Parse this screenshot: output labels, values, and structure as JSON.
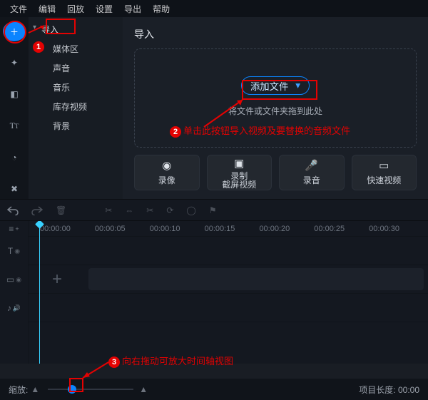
{
  "menu": [
    "文件",
    "编辑",
    "回放",
    "设置",
    "导出",
    "帮助"
  ],
  "side_tools": [
    {
      "name": "import-tool",
      "icon": "⊞",
      "active": true
    },
    {
      "name": "filters-tool",
      "icon": "✦"
    },
    {
      "name": "transitions-tool",
      "icon": "▣"
    },
    {
      "name": "titles-tool",
      "icon": "T"
    },
    {
      "name": "more-tool",
      "icon": "◔"
    },
    {
      "name": "tools-tool",
      "icon": "✕"
    }
  ],
  "import_tree": {
    "root": "导入",
    "items": [
      "媒体区",
      "声音",
      "音乐",
      "库存视频",
      "背景"
    ]
  },
  "main": {
    "title": "导入",
    "add_label": "添加文件",
    "drop_hint": "将文件或文件夹拖到此处"
  },
  "quick": [
    {
      "name": "record-camera",
      "icon": "⏺",
      "label": "录像",
      "two": null
    },
    {
      "name": "record-screen",
      "icon": "⧉",
      "line1": "录制",
      "line2": "截屏视频"
    },
    {
      "name": "record-audio",
      "icon": "🎤",
      "label": "录音",
      "two": null
    },
    {
      "name": "quick-video",
      "icon": "⧈",
      "label": "快速视频",
      "two": null
    }
  ],
  "toolbar": [
    "undo",
    "redo",
    "delete",
    "cut",
    "split",
    "crop",
    "rotate",
    "color",
    "flag"
  ],
  "ruler": [
    "00:00:00",
    "00:00:05",
    "00:00:10",
    "00:00:15",
    "00:00:20",
    "00:00:25",
    "00:00:30"
  ],
  "track_labels": [
    {
      "name": "add-track",
      "icon": "≡+"
    },
    {
      "name": "text-track",
      "icon": "T"
    },
    {
      "name": "video-track",
      "icon": "▭"
    },
    {
      "name": "audio-track",
      "icon": "♪"
    }
  ],
  "footer": {
    "zoom_label": "缩放:",
    "proj_label": "项目长度:",
    "proj_time": "00:00"
  },
  "annotations": {
    "n1": "1",
    "n2": "2",
    "n3": "3",
    "text2": "单击此按钮导入视频及要替换的音频文件",
    "text3": "向右拖动可放大时间轴视图"
  }
}
